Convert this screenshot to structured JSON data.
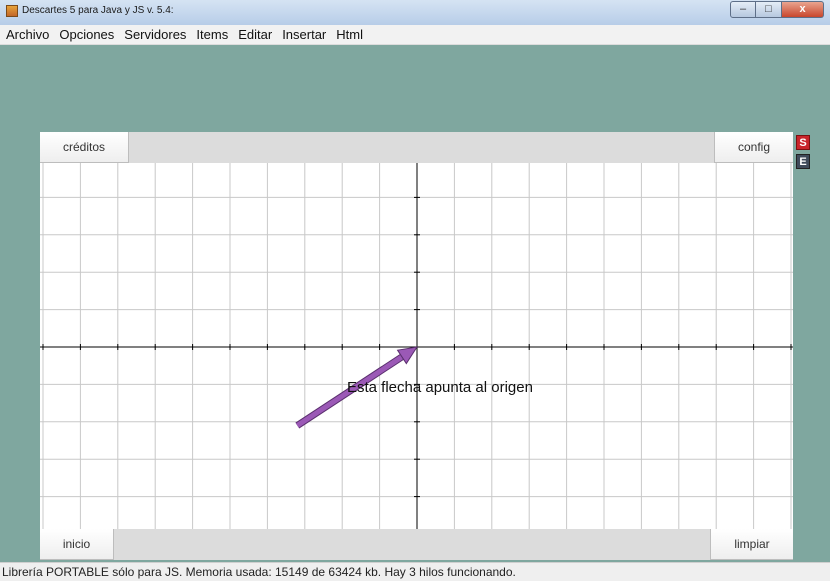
{
  "window": {
    "title": "Descartes 5 para Java y JS v. 5.4:",
    "buttons": {
      "minimize": "–",
      "maximize": "□",
      "close": "x"
    }
  },
  "menu": {
    "items": [
      "Archivo",
      "Opciones",
      "Servidores",
      "Items",
      "Editar",
      "Insertar",
      "Html"
    ]
  },
  "scene": {
    "buttons": {
      "creditos": "créditos",
      "config": "config",
      "inicio": "inicio",
      "limpiar": "limpiar"
    },
    "annotation": "Esta flecha apunta al origen",
    "arrow": {
      "from": [
        -3.2,
        -2.1
      ],
      "to": [
        0,
        0
      ],
      "color": "#9b59b6"
    },
    "axis_color": "#000000",
    "grid_color": "#c8c8c8"
  },
  "side_badges": {
    "s": "S",
    "e": "E"
  },
  "colors": {
    "workspace": "#7fa79f",
    "button_bar": "#dcdcdc",
    "arrow": "#9b59b6"
  },
  "status": {
    "text": "Librería PORTABLE sólo para JS. Memoria usada: 15149 de 63424 kb. Hay 3 hilos funcionando."
  }
}
